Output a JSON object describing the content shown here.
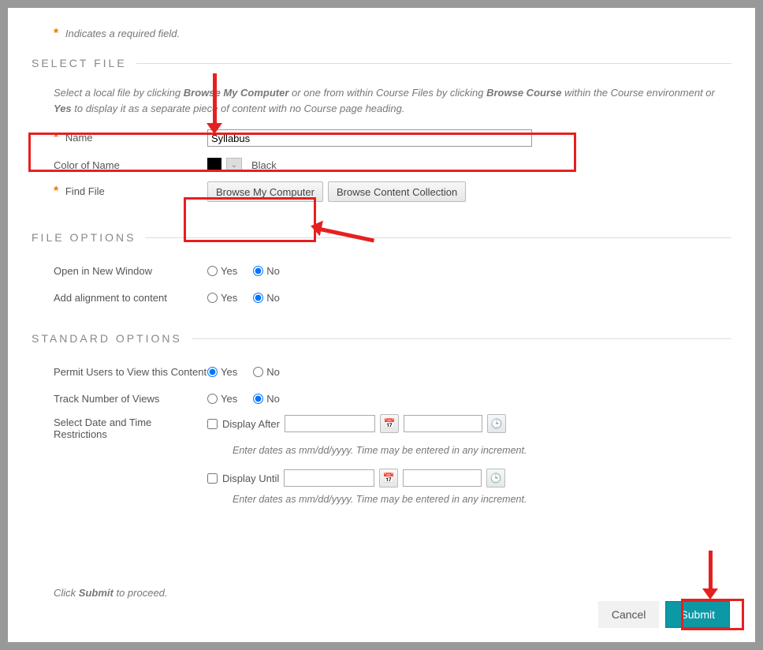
{
  "required_note": "Indicates a required field.",
  "sections": {
    "select_file": "SELECT FILE",
    "file_options": "FILE OPTIONS",
    "standard_options": "STANDARD OPTIONS"
  },
  "select_file": {
    "help": {
      "prefix": "Select a local file by clicking ",
      "bold1": "Browse My Computer",
      "mid1": " or one from within Course Files by clicking ",
      "bold2": "Browse Course",
      "mid2": " within the Course environment or ",
      "bold3": "Yes",
      "suffix": " to display it as a separate piece of content with no Course page heading."
    },
    "name_label": "Name",
    "name_value": "Syllabus",
    "color_label": "Color of Name",
    "color_name": "Black",
    "find_file_label": "Find File",
    "browse_computer": "Browse My Computer",
    "browse_collection": "Browse Content Collection"
  },
  "file_options": {
    "open_new_window": "Open in New Window",
    "add_alignment": "Add alignment to content",
    "yes": "Yes",
    "no": "No"
  },
  "standard_options": {
    "permit_view": "Permit Users to View this Content",
    "track_views": "Track Number of Views",
    "select_restrictions": "Select Date and Time Restrictions",
    "display_after": "Display After",
    "display_until": "Display Until",
    "date_hint": "Enter dates as mm/dd/yyyy. Time may be entered in any increment.",
    "yes": "Yes",
    "no": "No"
  },
  "footer": {
    "click": "Click ",
    "submit_bold": "Submit",
    "suffix": " to proceed.",
    "cancel": "Cancel",
    "submit": "Submit"
  }
}
